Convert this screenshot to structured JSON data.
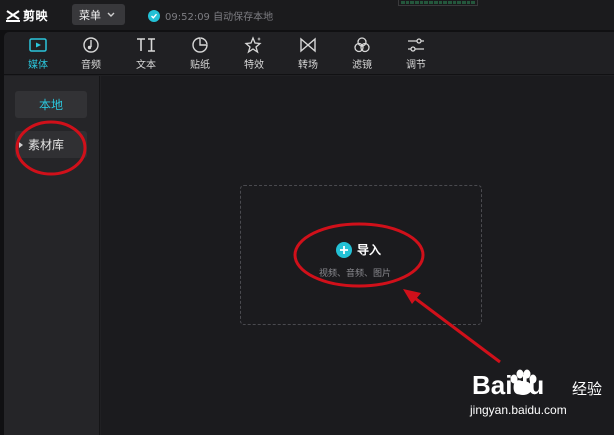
{
  "app": {
    "name": "剪映",
    "menu_label": "菜单",
    "save_status": "09:52:09 自动保存本地"
  },
  "toolbar": {
    "tabs": [
      {
        "label": "媒体",
        "icon": "media-icon",
        "active": true
      },
      {
        "label": "音频",
        "icon": "audio-icon",
        "active": false
      },
      {
        "label": "文本",
        "icon": "text-icon",
        "active": false
      },
      {
        "label": "贴纸",
        "icon": "sticker-icon",
        "active": false
      },
      {
        "label": "特效",
        "icon": "effects-icon",
        "active": false
      },
      {
        "label": "转场",
        "icon": "transition-icon",
        "active": false
      },
      {
        "label": "滤镜",
        "icon": "filter-icon",
        "active": false
      },
      {
        "label": "调节",
        "icon": "adjust-icon",
        "active": false
      }
    ]
  },
  "sidebar": {
    "items": [
      {
        "label": "本地",
        "active": true
      },
      {
        "label": "素材库",
        "active": false
      }
    ]
  },
  "dropzone": {
    "import_label": "导入",
    "subtitle": "视频、音频、图片"
  },
  "watermark": {
    "logo": "Baidu",
    "sub": "经验",
    "url": "jingyan.baidu.com"
  },
  "colors": {
    "accent": "#2bc6dc",
    "annotation": "#d0101a",
    "background": "#1b1b1e"
  }
}
